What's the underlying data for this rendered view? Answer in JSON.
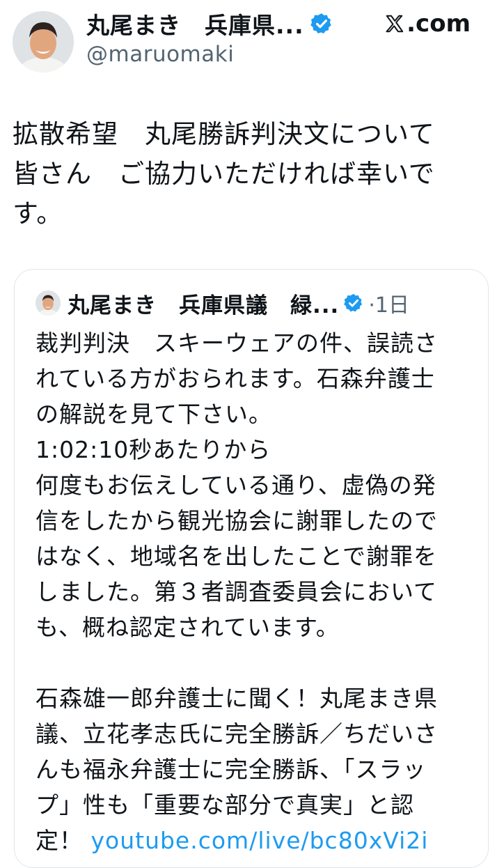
{
  "header": {
    "author_name": "丸尾まき　兵庫県...",
    "handle": "@maruomaki",
    "brand": ".com",
    "colors": {
      "verified": "#1d9bf0",
      "link": "#1d9bf0",
      "secondary_text": "#536471"
    }
  },
  "tweet": {
    "text": "拡散希望　丸尾勝訴判決文について\n皆さん　ご協力いただければ幸いで\nす。"
  },
  "quote": {
    "author_name": "丸尾まき　兵庫県議　緑...",
    "time": "·1日",
    "text": "裁判判決　スキーウェアの件、誤読さ\nれている方がおられます。石森弁護士\nの解説を見て下さい。\n1:02:10秒あたりから\n何度もお伝えしている通り、虚偽の発\n信をしたから観光協会に謝罪したので\nはなく、地域名を出したことで謝罪を\nしました。第３者調査委員会において\nも、概ね認定されています。\n\n石森雄一郎弁護士に聞く！丸尾まき県\n議、立花孝志氏に完全勝訴／ちだいさ\nんも福永弁護士に完全勝訴、「スラッ\nプ」性も「重要な部分で真実」と認\n定！ ",
    "link_text": "youtube.com/live/bc80xVi2i"
  },
  "icons": {
    "avatar": "profile-photo",
    "verified": "verified-badge-icon",
    "brand": "x-logo-icon"
  }
}
